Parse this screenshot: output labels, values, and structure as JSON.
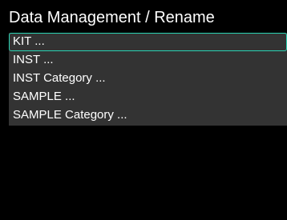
{
  "screen": {
    "title": "Data Management / Rename"
  },
  "menu": {
    "selected_index": 0,
    "accent_color": "#2ad4b4",
    "background_color": "#333333",
    "items": [
      {
        "label": "KIT ..."
      },
      {
        "label": "INST ..."
      },
      {
        "label": "INST Category ..."
      },
      {
        "label": "SAMPLE ..."
      },
      {
        "label": "SAMPLE Category ..."
      }
    ]
  }
}
